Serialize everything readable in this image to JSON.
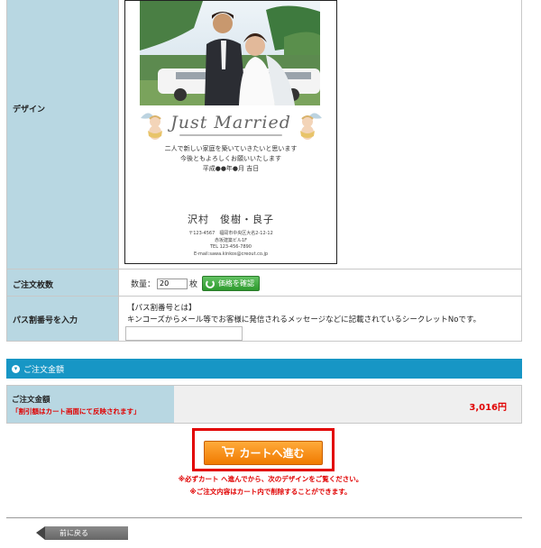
{
  "form": {
    "design_label": "デザイン",
    "quantity_label": "ご注文枚数",
    "passcode_label": "パス割番号を入力"
  },
  "design_card": {
    "script_title": "Just Married",
    "message_line1": "二人で新しい家庭を築いていきたいと思います",
    "message_line2": "今後ともよろしくお願いいたします",
    "message_line3": "平成●●年●月 吉日",
    "names": "沢村　俊樹・良子",
    "address_line1": "〒123-4567　福岡市中央区大名2-12-12",
    "address_line2": "赤坂建築ビル1F",
    "address_line3": "TEL 123-456-7890",
    "address_line4": "E-mail:sawa.kinkos@creout.co.jp"
  },
  "quantity": {
    "prefix": "数量：",
    "value": "20",
    "unit": "枚",
    "check_price_button": "価格を確認"
  },
  "passcode": {
    "title": "【パス割番号とは】",
    "description": "キンコーズからメール等でお客様に発信されるメッセージなどに記載されているシークレットNoです。"
  },
  "order": {
    "section_title": "ご注文金額",
    "total_label": "ご注文金額",
    "discount_note": "「割引額はカート画面にて反映されます」",
    "total_value": "3,016円"
  },
  "cart": {
    "button_label": "カートへ進む",
    "note1": "※必ずカート へ進んでから、次のデザインをご覧ください。",
    "note2": "※ご注文内容はカート内で削除することができます。"
  },
  "nav": {
    "back_label": "前に戻る"
  },
  "colors": {
    "accent": "#1796c5",
    "label_bg": "#b8d7e2",
    "cart_orange": "#f07a00",
    "alert_red": "#e00000",
    "check_green": "#2d9a2d"
  }
}
